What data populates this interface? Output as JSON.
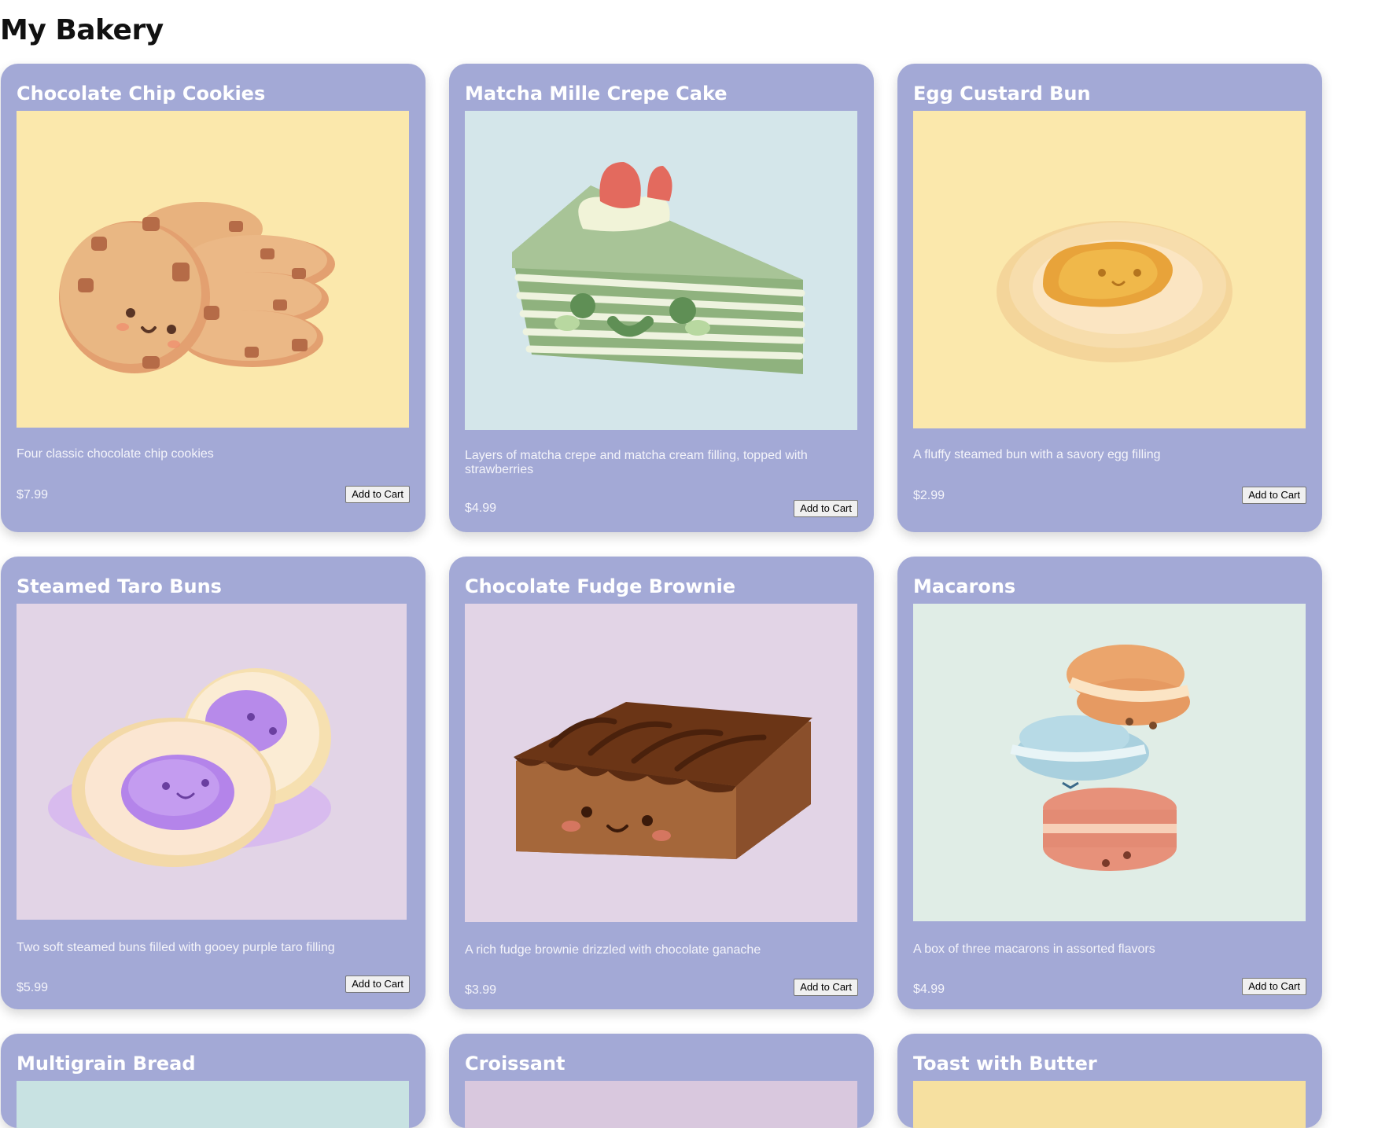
{
  "page": {
    "title": "My Bakery"
  },
  "products": [
    {
      "name": "Chocolate Chip Cookies",
      "description": "Four classic chocolate chip cookies",
      "price": "$7.99",
      "button": "Add to Cart",
      "image_bg": "#fbe8ac",
      "image": "cookies-illustration"
    },
    {
      "name": "Matcha Mille Crepe Cake",
      "description": "Layers of matcha crepe and matcha cream filling, topped with strawberries",
      "price": "$4.99",
      "button": "Add to Cart",
      "image_bg": "#d4e6ea",
      "image": "crepe-cake-illustration"
    },
    {
      "name": "Egg Custard Bun",
      "description": "A fluffy steamed bun with a savory egg filling",
      "price": "$2.99",
      "button": "Add to Cart",
      "image_bg": "#fbe8ac",
      "image": "custard-bun-illustration"
    },
    {
      "name": "Steamed Taro Buns",
      "description": "Two soft steamed buns filled with gooey purple taro filling",
      "price": "$5.99",
      "button": "Add to Cart",
      "image_bg": "#e2d4e6",
      "image": "taro-buns-illustration"
    },
    {
      "name": "Chocolate Fudge Brownie",
      "description": "A rich fudge brownie drizzled with chocolate ganache",
      "price": "$3.99",
      "button": "Add to Cart",
      "image_bg": "#e2d4e6",
      "image": "brownie-illustration"
    },
    {
      "name": "Macarons",
      "description": "A box of three macarons in assorted flavors",
      "price": "$4.99",
      "button": "Add to Cart",
      "image_bg": "#e0ede6",
      "image": "macarons-illustration"
    },
    {
      "name": "Multigrain Bread",
      "image_bg": "#c8e2e2"
    },
    {
      "name": "Croissant",
      "image_bg": "#d9c8de"
    },
    {
      "name": "Toast with Butter",
      "image_bg": "#f6e0a0"
    }
  ],
  "colors": {
    "card_bg": "#a3a9d6",
    "text_light": "#f4f4fa"
  }
}
